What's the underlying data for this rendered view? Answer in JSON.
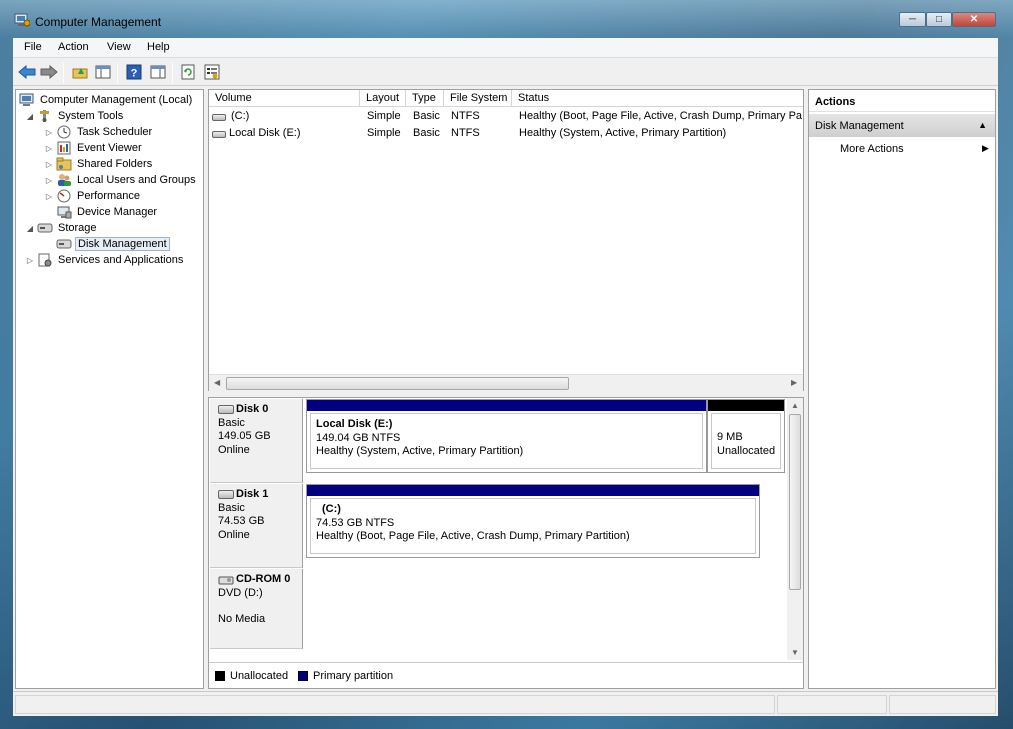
{
  "window": {
    "title": "Computer Management",
    "min_glyph": "─",
    "max_glyph": "□",
    "close_glyph": "✕"
  },
  "menu": [
    "File",
    "Action",
    "View",
    "Help"
  ],
  "toolbar": {
    "buttons": [
      "back-icon",
      "forward-icon",
      "up-folder-icon",
      "show-hide-tree-icon",
      "help-icon",
      "show-hide-action-pane-icon",
      "refresh-icon",
      "properties-icon"
    ]
  },
  "tree": {
    "root": "Computer Management (Local)",
    "system_tools": "System Tools",
    "task_scheduler": "Task Scheduler",
    "event_viewer": "Event Viewer",
    "shared_folders": "Shared Folders",
    "local_users": "Local Users and Groups",
    "performance": "Performance",
    "device_manager": "Device Manager",
    "storage": "Storage",
    "disk_management": "Disk Management",
    "services": "Services and Applications"
  },
  "volumes": {
    "columns": [
      "Volume",
      "Layout",
      "Type",
      "File System",
      "Status"
    ],
    "rows": [
      {
        "volume": "(C:)",
        "layout": "Simple",
        "type": "Basic",
        "fs": "NTFS",
        "status": "Healthy (Boot, Page File, Active, Crash Dump, Primary Pa"
      },
      {
        "volume": "Local Disk (E:)",
        "layout": "Simple",
        "type": "Basic",
        "fs": "NTFS",
        "status": "Healthy (System, Active, Primary Partition)"
      }
    ]
  },
  "disks": {
    "disk0": {
      "name": "Disk 0",
      "kind": "Basic",
      "size": "149.05 GB",
      "state": "Online",
      "vol1": {
        "name": "Local Disk  (E:)",
        "size": "149.04 GB NTFS",
        "status": "Healthy (System, Active, Primary Partition)"
      },
      "vol2": {
        "size": "9 MB",
        "status": "Unallocated"
      }
    },
    "disk1": {
      "name": "Disk 1",
      "kind": "Basic",
      "size": "74.53 GB",
      "state": "Online",
      "vol1": {
        "name": "(C:)",
        "size": "74.53 GB NTFS",
        "status": "Healthy (Boot, Page File, Active, Crash Dump, Primary Partition)"
      }
    },
    "cdrom0": {
      "name": "CD-ROM 0",
      "kind": "DVD (D:)",
      "state": "No Media"
    }
  },
  "legend": {
    "unallocated": "Unallocated",
    "primary": "Primary partition"
  },
  "actions": {
    "title": "Actions",
    "section": "Disk Management",
    "more": "More Actions"
  },
  "colors": {
    "primary_partition": "#000080",
    "unallocated": "#000000"
  }
}
